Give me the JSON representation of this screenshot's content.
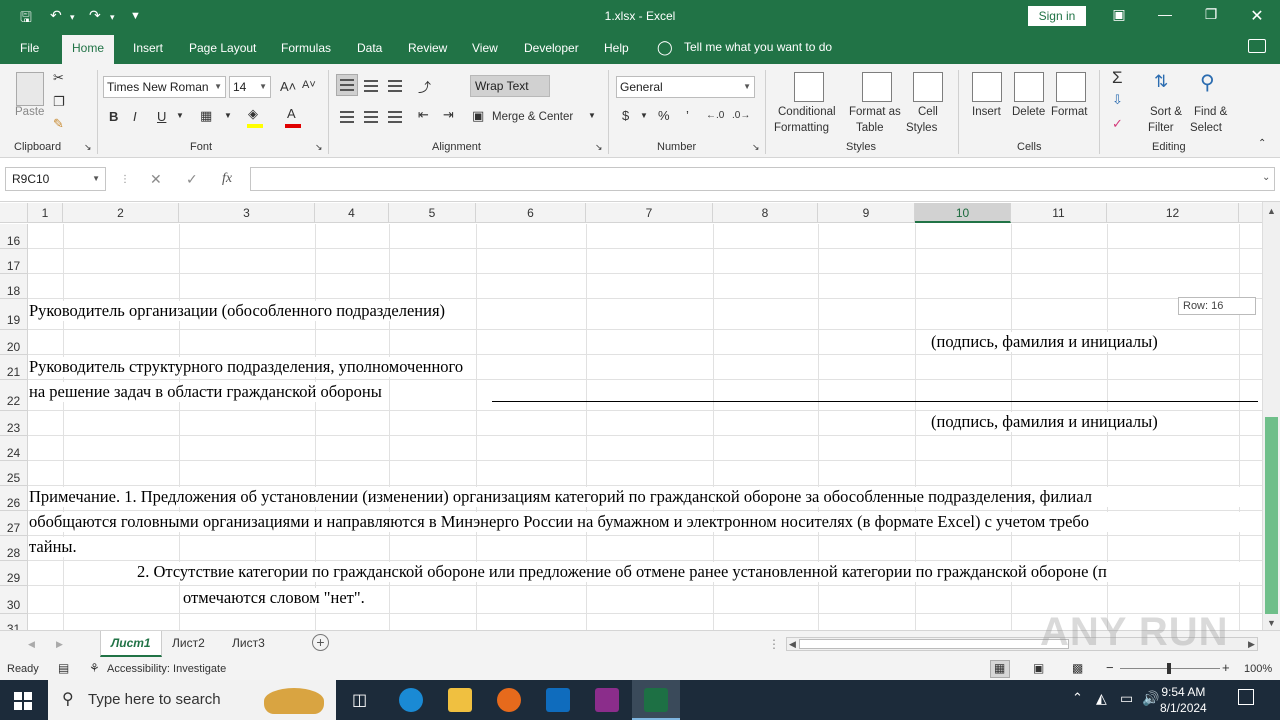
{
  "app": {
    "title": "1.xlsx  -  Excel",
    "signin": "Sign in"
  },
  "menu": {
    "tabs": [
      "File",
      "Home",
      "Insert",
      "Page Layout",
      "Formulas",
      "Data",
      "Review",
      "View",
      "Developer",
      "Help"
    ],
    "active": "Home",
    "tellme": "Tell me what you want to do"
  },
  "ribbon": {
    "clipboard": {
      "paste": "Paste",
      "label": "Clipboard"
    },
    "font": {
      "name": "Times New Roman",
      "size": "14",
      "label": "Font",
      "bold": "B",
      "italic": "I",
      "underline": "U"
    },
    "alignment": {
      "wrap": "Wrap Text",
      "merge": "Merge & Center",
      "label": "Alignment"
    },
    "number": {
      "format": "General",
      "label": "Number",
      "currency": "$",
      "percent": "%",
      "comma": "’"
    },
    "styles": {
      "conditional": "Conditional",
      "conditional2": "Formatting",
      "formatas": "Format as",
      "formatas2": "Table",
      "cell": "Cell",
      "cell2": "Styles",
      "label": "Styles"
    },
    "cells": {
      "insert": "Insert",
      "delete": "Delete",
      "format": "Format",
      "label": "Cells"
    },
    "editing": {
      "sort": "Sort &",
      "sort2": "Filter",
      "find": "Find &",
      "find2": "Select",
      "label": "Editing"
    }
  },
  "formula_bar": {
    "namebox": "R9C10",
    "fx": "fx",
    "cancel": "✕",
    "enter": "✓",
    "value": ""
  },
  "grid": {
    "columns": [
      "1",
      "2",
      "3",
      "4",
      "5",
      "6",
      "7",
      "8",
      "9",
      "10",
      "11",
      "12"
    ],
    "selected_column": "10",
    "rows": [
      "16",
      "17",
      "18",
      "19",
      "20",
      "21",
      "22",
      "23",
      "24",
      "25",
      "26",
      "27",
      "28",
      "29",
      "30",
      "31"
    ],
    "row_tip": "Row: 16",
    "cells": {
      "r19": "Руководитель организации (обособленного подразделения)",
      "r20": "(подпись, фамилия и инициалы)",
      "r21": "Руководитель структурного подразделения, уполномоченного",
      "r22": "на решение задач в области гражданской обороны",
      "r23": "(подпись, фамилия и инициалы)",
      "r26": "Примечание. 1. Предложения об установлении (изменении) организациям категорий по гражданской обороне за обособленные подразделения, филиал",
      "r27": "обобщаются головными организациями и направляются в Минэнерго России на бумажном и электронном носителях (в формате Excel) с учетом требо",
      "r28": "тайны.",
      "r29": "2. Отсутствие категории по гражданской обороне или предложение об отмене ранее установленной категории по гражданской обороне (п",
      "r30": "отмечаются словом \"нет\"."
    }
  },
  "sheets": {
    "tabs": [
      "Лист1",
      "Лист2",
      "Лист3"
    ],
    "active": "Лист1"
  },
  "status": {
    "ready": "Ready",
    "accessibility": "Accessibility: Investigate",
    "zoom": "100%"
  },
  "taskbar": {
    "search_placeholder": "Type here to search",
    "time": "9:54 AM",
    "date": "8/1/2024"
  },
  "watermark": "ANY RUN"
}
